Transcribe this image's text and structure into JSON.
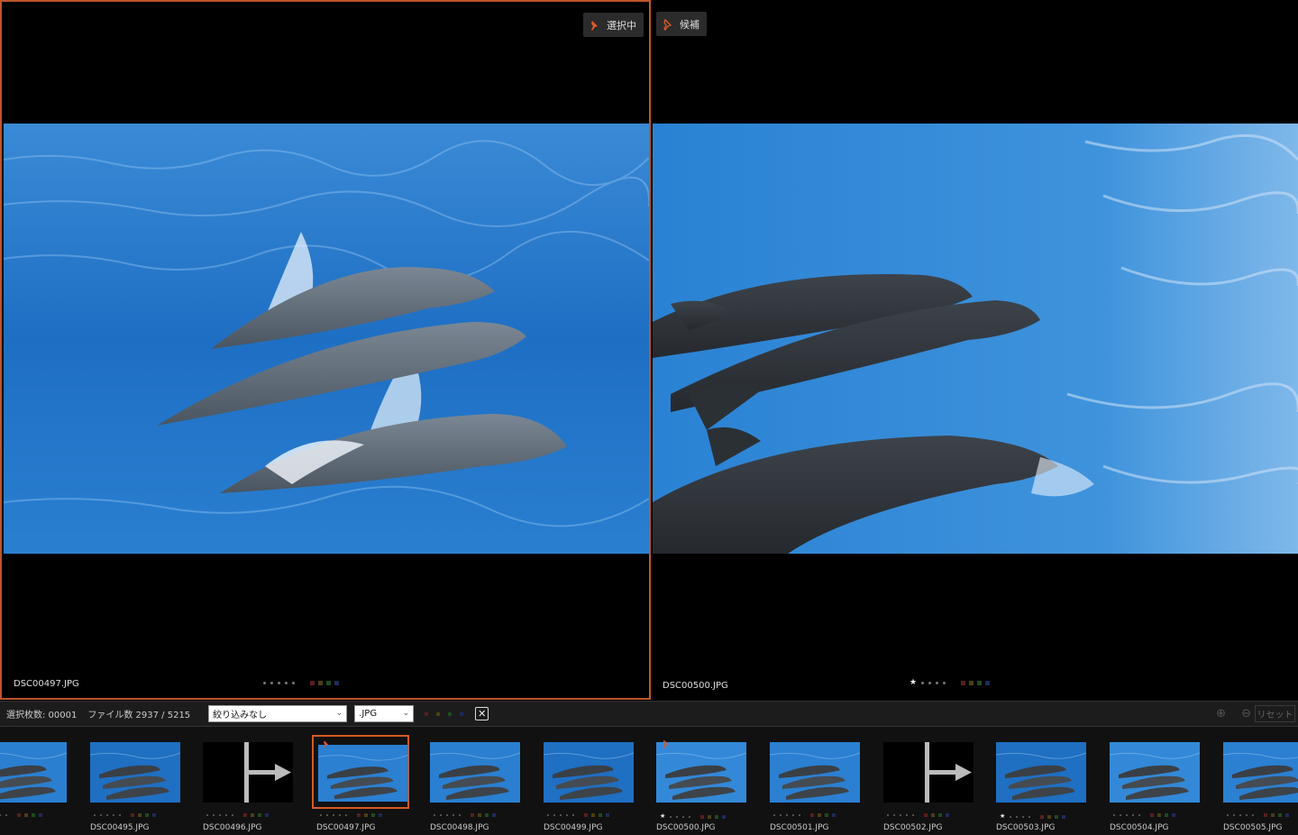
{
  "left_pane": {
    "filename": "DSC00497.JPG",
    "badge_label": "選択中",
    "rating_stars": 0
  },
  "right_pane": {
    "filename": "DSC00500.JPG",
    "badge_label": "候補",
    "rating_stars": 1
  },
  "toolbar": {
    "selected_count": "選択枚数: 00001",
    "file_count": "ファイル数 2937 / 5215",
    "filter_value": "絞り込みなし",
    "extension_value": ".JPG",
    "clear_label": "✕",
    "reset_label": "リセット"
  },
  "colors": {
    "accent": "#d65a22",
    "label_red": "#5a1e1e",
    "label_yellow": "#4a3f12",
    "label_green": "#1e4a22",
    "label_blue": "#1e2a5a"
  },
  "filmstrip": [
    {
      "name": ".JPG",
      "kind": "photo",
      "stars": 0
    },
    {
      "name": "DSC00495.JPG",
      "kind": "photo",
      "stars": 0
    },
    {
      "name": "DSC00496.JPG",
      "kind": "placeholder",
      "stars": 0
    },
    {
      "name": "DSC00497.JPG",
      "kind": "photo",
      "stars": 0,
      "selected": true,
      "pinned": "selected"
    },
    {
      "name": "DSC00498.JPG",
      "kind": "photo",
      "stars": 0
    },
    {
      "name": "DSC00499.JPG",
      "kind": "photo",
      "stars": 0
    },
    {
      "name": "DSC00500.JPG",
      "kind": "photo",
      "stars": 1,
      "pinned": "candidate"
    },
    {
      "name": "DSC00501.JPG",
      "kind": "photo",
      "stars": 0
    },
    {
      "name": "DSC00502.JPG",
      "kind": "placeholder",
      "stars": 0
    },
    {
      "name": "DSC00503.JPG",
      "kind": "photo",
      "stars": 1
    },
    {
      "name": "DSC00504.JPG",
      "kind": "photo",
      "stars": 0
    },
    {
      "name": "DSC00505.JPG",
      "kind": "photo",
      "stars": 0
    }
  ]
}
